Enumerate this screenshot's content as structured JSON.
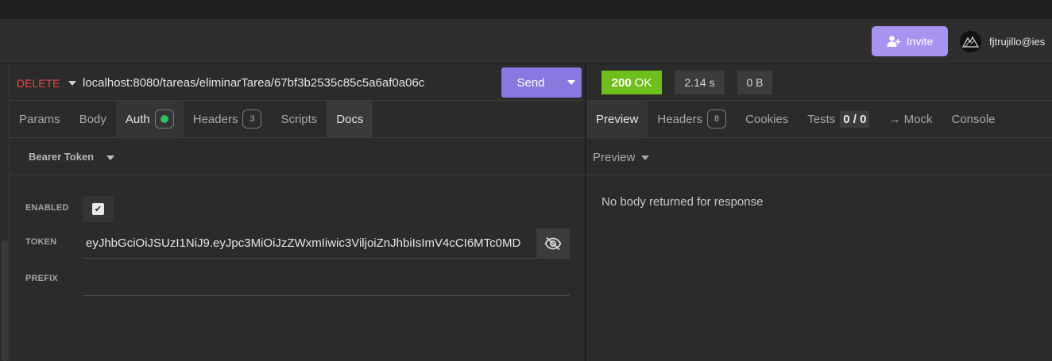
{
  "header": {
    "invite_label": "Invite",
    "user_email": "fjtrujillo@ies"
  },
  "request": {
    "method": "DELETE",
    "url": "localhost:8080/tareas/eliminarTarea/67bf3b2535c85c5a6af0a06c",
    "send_label": "Send",
    "tabs": [
      {
        "label": "Params"
      },
      {
        "label": "Body"
      },
      {
        "label": "Auth"
      },
      {
        "label": "Headers",
        "count": "3"
      },
      {
        "label": "Scripts"
      },
      {
        "label": "Docs"
      }
    ]
  },
  "auth": {
    "type_label": "Bearer Token",
    "enabled_label": "ENABLED",
    "enabled_checked": true,
    "token_label": "TOKEN",
    "token_value": "eyJhbGciOiJSUzI1NiJ9.eyJpc3MiOiJzZWxmIiwic3ViljoiZnJhbiIsImV4cCI6MTc0MD",
    "prefix_label": "PREFIX",
    "prefix_value": ""
  },
  "response": {
    "status_code": "200",
    "status_text": "OK",
    "time": "2.14 s",
    "size": "0 B",
    "tabs": [
      {
        "label": "Preview"
      },
      {
        "label": "Headers",
        "count": "8"
      },
      {
        "label": "Cookies"
      },
      {
        "label": "Tests",
        "score": "0 / 0"
      },
      {
        "label": "→ Mock"
      },
      {
        "label": "Console"
      }
    ],
    "preview_mode": "Preview",
    "empty_message": "No body returned for response"
  },
  "colors": {
    "method_delete": "#e5484d",
    "accent": "#8b77e0",
    "invite": "#a893f0",
    "status_ok": "#6fbf1c",
    "auth_dot": "#2fbf5b"
  }
}
